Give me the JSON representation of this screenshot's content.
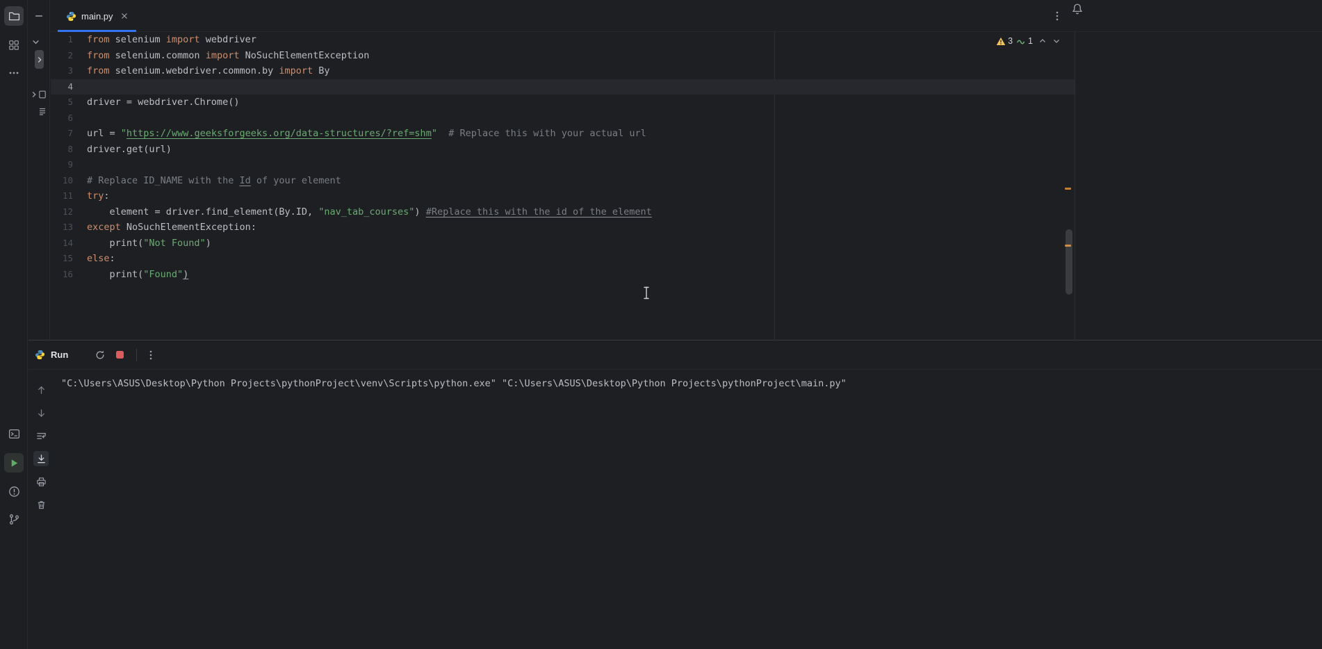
{
  "topbar": {
    "tab": {
      "label": "main.py",
      "icon": "python-icon",
      "close_icon": "close-icon",
      "active": true
    },
    "more_actions_icon": "kebab-icon",
    "notifications_icon": "bell-icon"
  },
  "activity_bar": {
    "top": [
      {
        "name": "project",
        "icon": "folder-icon",
        "active": true
      },
      {
        "name": "structure",
        "icon": "structure-icon",
        "active": false
      },
      {
        "name": "more-tool-windows",
        "icon": "more-icon",
        "active": false
      }
    ],
    "bottom": [
      {
        "name": "terminal",
        "icon": "terminal-icon",
        "active": false
      },
      {
        "name": "run",
        "icon": "run-icon",
        "active": true
      },
      {
        "name": "problems",
        "icon": "problems-icon",
        "active": false
      },
      {
        "name": "version-control",
        "icon": "git-branch-icon",
        "active": false
      }
    ]
  },
  "project_strip": {
    "hide_icon": "minimize-icon",
    "icons": [
      "chevron-down-icon",
      "chevron-right-icon",
      "chevron-right-icon",
      "file-icon",
      "list-icon"
    ]
  },
  "editor": {
    "inspection_widget": {
      "warning_icon": "warning-triangle-icon",
      "warning_count": "3",
      "typo_icon": "typo-squiggle-icon",
      "typo_count": "1",
      "prev_icon": "chevron-up-icon",
      "next_icon": "chevron-down-icon"
    },
    "lines": [
      {
        "no": "1",
        "tokens": [
          {
            "t": "from",
            "c": "keyword"
          },
          {
            "t": " selenium ",
            "c": "plain"
          },
          {
            "t": "import",
            "c": "keyword"
          },
          {
            "t": " webdriver",
            "c": "plain"
          }
        ]
      },
      {
        "no": "2",
        "tokens": [
          {
            "t": "from",
            "c": "keyword"
          },
          {
            "t": " selenium.common ",
            "c": "plain"
          },
          {
            "t": "import",
            "c": "keyword"
          },
          {
            "t": " NoSuchElementException",
            "c": "plain"
          }
        ]
      },
      {
        "no": "3",
        "tokens": [
          {
            "t": "from",
            "c": "keyword"
          },
          {
            "t": " selenium.webdriver.common.by ",
            "c": "plain"
          },
          {
            "t": "import",
            "c": "keyword"
          },
          {
            "t": " By",
            "c": "plain"
          }
        ]
      },
      {
        "no": "4",
        "current": true,
        "tokens": []
      },
      {
        "no": "5",
        "tokens": [
          {
            "t": "driver = webdriver.Chrome()",
            "c": "plain"
          }
        ]
      },
      {
        "no": "6",
        "tokens": []
      },
      {
        "no": "7",
        "tokens": [
          {
            "t": "url = ",
            "c": "plain"
          },
          {
            "t": "\"",
            "c": "string"
          },
          {
            "t": "https://www.geeksforgeeks.org/data-structures/?ref=shm",
            "c": "string-link"
          },
          {
            "t": "\"",
            "c": "string"
          },
          {
            "t": "  ",
            "c": "plain"
          },
          {
            "t": "# Replace this with your actual url",
            "c": "comment"
          }
        ]
      },
      {
        "no": "8",
        "tokens": [
          {
            "t": "driver.get(url)",
            "c": "plain"
          }
        ]
      },
      {
        "no": "9",
        "tokens": []
      },
      {
        "no": "10",
        "tokens": [
          {
            "t": "# Replace ID_NAME with the ",
            "c": "comment"
          },
          {
            "t": "Id",
            "c": "comment-underline"
          },
          {
            "t": " of your element",
            "c": "comment"
          }
        ]
      },
      {
        "no": "11",
        "tokens": [
          {
            "t": "try",
            "c": "keyword"
          },
          {
            "t": ":",
            "c": "plain"
          }
        ]
      },
      {
        "no": "12",
        "tokens": [
          {
            "t": "    element = driver.find_element(By.ID, ",
            "c": "plain"
          },
          {
            "t": "\"nav_tab_courses\"",
            "c": "string"
          },
          {
            "t": ") ",
            "c": "plain"
          },
          {
            "t": "#Replace this with the id of the element",
            "c": "comment-underline"
          }
        ]
      },
      {
        "no": "13",
        "tokens": [
          {
            "t": "except",
            "c": "keyword"
          },
          {
            "t": " NoSuchElementException:",
            "c": "plain"
          }
        ]
      },
      {
        "no": "14",
        "tokens": [
          {
            "t": "    print(",
            "c": "plain"
          },
          {
            "t": "\"Not Found\"",
            "c": "string"
          },
          {
            "t": ")",
            "c": "plain"
          }
        ]
      },
      {
        "no": "15",
        "tokens": [
          {
            "t": "else",
            "c": "keyword"
          },
          {
            "t": ":",
            "c": "plain"
          }
        ]
      },
      {
        "no": "16",
        "tokens": [
          {
            "t": "    print(",
            "c": "plain"
          },
          {
            "t": "\"Found\"",
            "c": "string"
          },
          {
            "t": ")",
            "c": "plain-underline"
          }
        ]
      }
    ]
  },
  "run_panel": {
    "title": "Run",
    "title_icon": "python-icon",
    "toolbar_icons": [
      "rerun-icon",
      "stop-icon",
      "kebab-icon"
    ],
    "console_toolbar_icons": [
      "arrow-up-icon",
      "arrow-down-icon",
      "soft-wrap-icon",
      "scroll-to-end-icon",
      "print-icon",
      "clear-icon"
    ],
    "console_lines": [
      "\"C:\\Users\\ASUS\\Desktop\\Python Projects\\pythonProject\\venv\\Scripts\\python.exe\" \"C:\\Users\\ASUS\\Desktop\\Python Projects\\pythonProject\\main.py\""
    ]
  },
  "colors": {
    "accent": "#3574f0",
    "editor_bg": "#1e1f22",
    "current_line": "#26282e",
    "keyword": "#cf8e6d",
    "string": "#6aab73",
    "comment": "#7a7e85",
    "plain_text": "#bcbec4",
    "line_number": "#4b5059",
    "warning": "#f2c55c",
    "stop_red": "#db5c5c",
    "run_green": "#5fad65",
    "scroll_mark_orange": "#c57f33"
  }
}
